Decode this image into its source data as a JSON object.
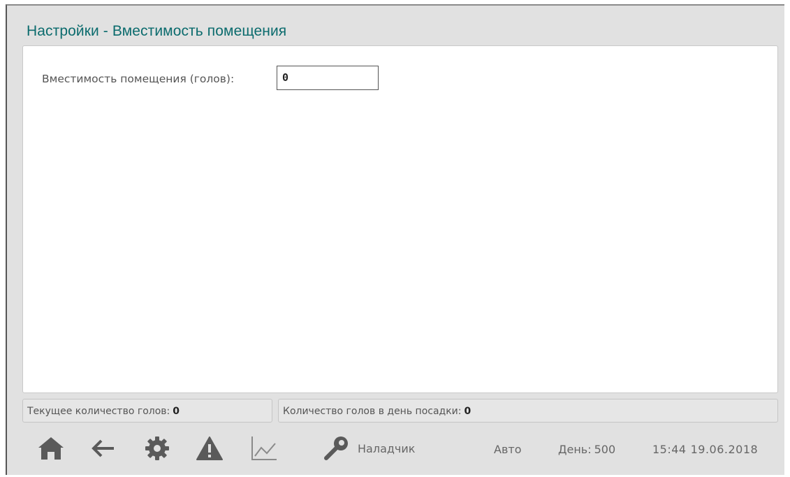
{
  "header": {
    "title": "Настройки - Вместимость помещения"
  },
  "form": {
    "capacity_label": "Вместимость помещения (голов):",
    "capacity_value": "0"
  },
  "status": {
    "current_label": "Текущее количество голов:",
    "current_value": "0",
    "planting_label": "Количество голов в день посадки:",
    "planting_value": "0"
  },
  "toolbar": {
    "icons": [
      "home-icon",
      "back-arrow-icon",
      "gear-icon",
      "warning-icon",
      "chart-icon",
      "key-icon"
    ],
    "role": "Наладчик",
    "mode": "Авто",
    "day_label": "День:",
    "day_value": "500",
    "time": "15:44",
    "date": "19.06.2018"
  },
  "colors": {
    "title": "#0b6b6d",
    "icon": "#5a5a5a",
    "panel_bg": "#e1e1e1"
  }
}
